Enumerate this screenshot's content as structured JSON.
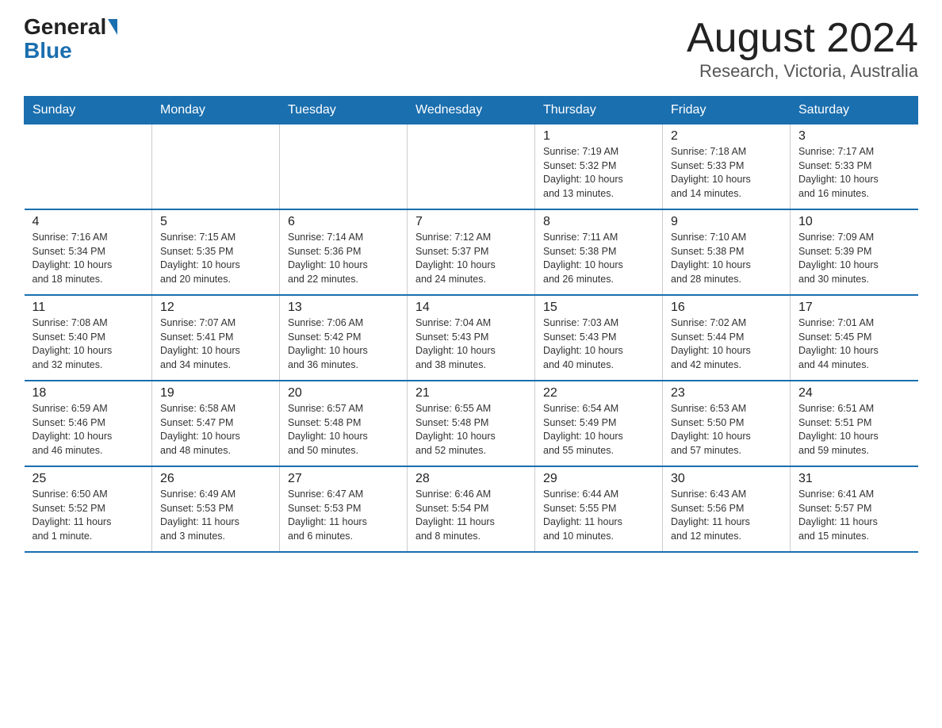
{
  "header": {
    "logo_general": "General",
    "logo_blue": "Blue",
    "month_title": "August 2024",
    "location": "Research, Victoria, Australia"
  },
  "weekdays": [
    "Sunday",
    "Monday",
    "Tuesday",
    "Wednesday",
    "Thursday",
    "Friday",
    "Saturday"
  ],
  "weeks": [
    [
      {
        "day": "",
        "info": ""
      },
      {
        "day": "",
        "info": ""
      },
      {
        "day": "",
        "info": ""
      },
      {
        "day": "",
        "info": ""
      },
      {
        "day": "1",
        "info": "Sunrise: 7:19 AM\nSunset: 5:32 PM\nDaylight: 10 hours\nand 13 minutes."
      },
      {
        "day": "2",
        "info": "Sunrise: 7:18 AM\nSunset: 5:33 PM\nDaylight: 10 hours\nand 14 minutes."
      },
      {
        "day": "3",
        "info": "Sunrise: 7:17 AM\nSunset: 5:33 PM\nDaylight: 10 hours\nand 16 minutes."
      }
    ],
    [
      {
        "day": "4",
        "info": "Sunrise: 7:16 AM\nSunset: 5:34 PM\nDaylight: 10 hours\nand 18 minutes."
      },
      {
        "day": "5",
        "info": "Sunrise: 7:15 AM\nSunset: 5:35 PM\nDaylight: 10 hours\nand 20 minutes."
      },
      {
        "day": "6",
        "info": "Sunrise: 7:14 AM\nSunset: 5:36 PM\nDaylight: 10 hours\nand 22 minutes."
      },
      {
        "day": "7",
        "info": "Sunrise: 7:12 AM\nSunset: 5:37 PM\nDaylight: 10 hours\nand 24 minutes."
      },
      {
        "day": "8",
        "info": "Sunrise: 7:11 AM\nSunset: 5:38 PM\nDaylight: 10 hours\nand 26 minutes."
      },
      {
        "day": "9",
        "info": "Sunrise: 7:10 AM\nSunset: 5:38 PM\nDaylight: 10 hours\nand 28 minutes."
      },
      {
        "day": "10",
        "info": "Sunrise: 7:09 AM\nSunset: 5:39 PM\nDaylight: 10 hours\nand 30 minutes."
      }
    ],
    [
      {
        "day": "11",
        "info": "Sunrise: 7:08 AM\nSunset: 5:40 PM\nDaylight: 10 hours\nand 32 minutes."
      },
      {
        "day": "12",
        "info": "Sunrise: 7:07 AM\nSunset: 5:41 PM\nDaylight: 10 hours\nand 34 minutes."
      },
      {
        "day": "13",
        "info": "Sunrise: 7:06 AM\nSunset: 5:42 PM\nDaylight: 10 hours\nand 36 minutes."
      },
      {
        "day": "14",
        "info": "Sunrise: 7:04 AM\nSunset: 5:43 PM\nDaylight: 10 hours\nand 38 minutes."
      },
      {
        "day": "15",
        "info": "Sunrise: 7:03 AM\nSunset: 5:43 PM\nDaylight: 10 hours\nand 40 minutes."
      },
      {
        "day": "16",
        "info": "Sunrise: 7:02 AM\nSunset: 5:44 PM\nDaylight: 10 hours\nand 42 minutes."
      },
      {
        "day": "17",
        "info": "Sunrise: 7:01 AM\nSunset: 5:45 PM\nDaylight: 10 hours\nand 44 minutes."
      }
    ],
    [
      {
        "day": "18",
        "info": "Sunrise: 6:59 AM\nSunset: 5:46 PM\nDaylight: 10 hours\nand 46 minutes."
      },
      {
        "day": "19",
        "info": "Sunrise: 6:58 AM\nSunset: 5:47 PM\nDaylight: 10 hours\nand 48 minutes."
      },
      {
        "day": "20",
        "info": "Sunrise: 6:57 AM\nSunset: 5:48 PM\nDaylight: 10 hours\nand 50 minutes."
      },
      {
        "day": "21",
        "info": "Sunrise: 6:55 AM\nSunset: 5:48 PM\nDaylight: 10 hours\nand 52 minutes."
      },
      {
        "day": "22",
        "info": "Sunrise: 6:54 AM\nSunset: 5:49 PM\nDaylight: 10 hours\nand 55 minutes."
      },
      {
        "day": "23",
        "info": "Sunrise: 6:53 AM\nSunset: 5:50 PM\nDaylight: 10 hours\nand 57 minutes."
      },
      {
        "day": "24",
        "info": "Sunrise: 6:51 AM\nSunset: 5:51 PM\nDaylight: 10 hours\nand 59 minutes."
      }
    ],
    [
      {
        "day": "25",
        "info": "Sunrise: 6:50 AM\nSunset: 5:52 PM\nDaylight: 11 hours\nand 1 minute."
      },
      {
        "day": "26",
        "info": "Sunrise: 6:49 AM\nSunset: 5:53 PM\nDaylight: 11 hours\nand 3 minutes."
      },
      {
        "day": "27",
        "info": "Sunrise: 6:47 AM\nSunset: 5:53 PM\nDaylight: 11 hours\nand 6 minutes."
      },
      {
        "day": "28",
        "info": "Sunrise: 6:46 AM\nSunset: 5:54 PM\nDaylight: 11 hours\nand 8 minutes."
      },
      {
        "day": "29",
        "info": "Sunrise: 6:44 AM\nSunset: 5:55 PM\nDaylight: 11 hours\nand 10 minutes."
      },
      {
        "day": "30",
        "info": "Sunrise: 6:43 AM\nSunset: 5:56 PM\nDaylight: 11 hours\nand 12 minutes."
      },
      {
        "day": "31",
        "info": "Sunrise: 6:41 AM\nSunset: 5:57 PM\nDaylight: 11 hours\nand 15 minutes."
      }
    ]
  ]
}
